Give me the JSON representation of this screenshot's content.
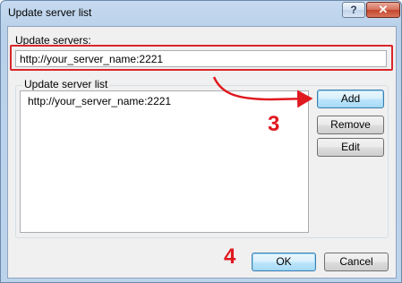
{
  "window": {
    "title": "Update server list"
  },
  "titlebar": {
    "help_label": "?",
    "close_label": "✕"
  },
  "form": {
    "servers_label": "Update servers:",
    "url_value": "http://your_server_name:2221"
  },
  "list_group": {
    "title": "Update server list",
    "items": [
      "http://your_server_name:2221"
    ]
  },
  "buttons": {
    "add": "Add",
    "remove": "Remove",
    "edit": "Edit",
    "ok": "OK",
    "cancel": "Cancel"
  },
  "annotations": {
    "step3": "3",
    "step4": "4",
    "color": "#e0191f"
  }
}
